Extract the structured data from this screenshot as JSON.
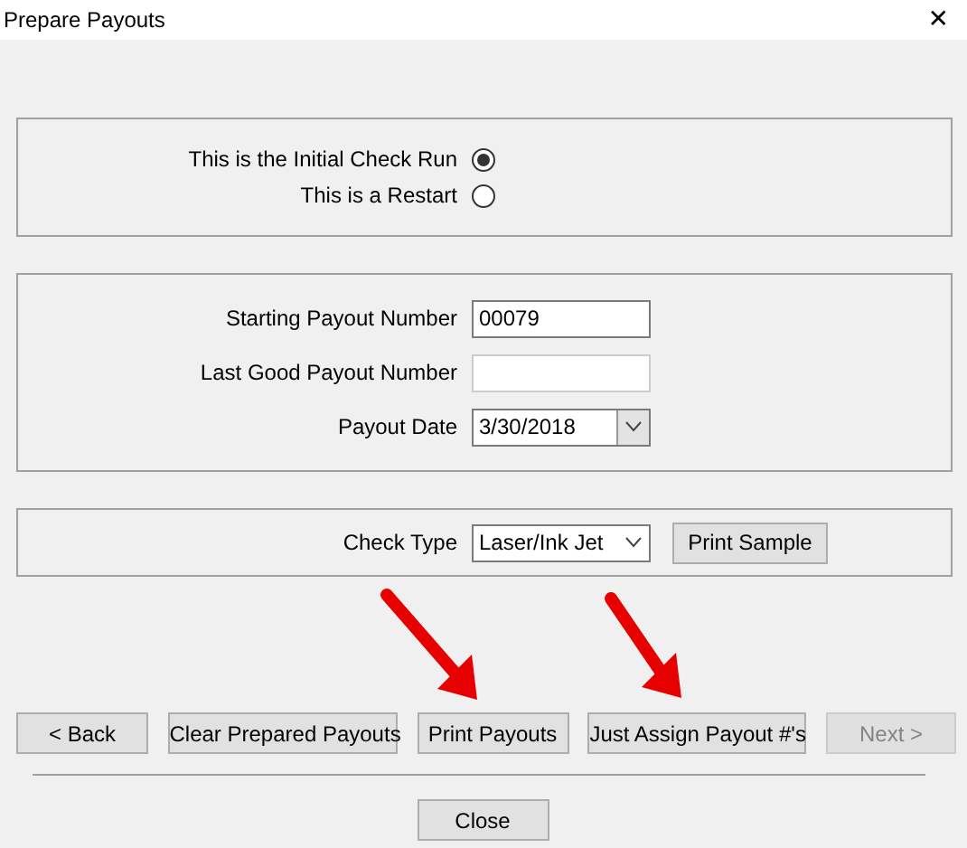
{
  "window": {
    "title": "Prepare Payouts",
    "close": "✕"
  },
  "run_type": [
    {
      "label": "This is the Initial Check Run",
      "selected": true
    },
    {
      "label": "This is a Restart",
      "selected": false
    }
  ],
  "payout_fields": [
    {
      "kind": "text",
      "label": "Starting Payout Number",
      "value": "00079",
      "disabled": false
    },
    {
      "kind": "text",
      "label": "Last Good Payout Number",
      "disabled": true
    },
    {
      "kind": "date",
      "label": "Payout Date",
      "value": "3/30/2018",
      "disabled": false
    }
  ],
  "check_type": {
    "label": "Check Type",
    "value": "Laser/Ink Jet",
    "button": "Print Sample"
  },
  "buttons": [
    {
      "label": "<  Back",
      "disabled": false
    },
    {
      "label": "Clear Prepared Payouts",
      "disabled": false
    },
    {
      "label": "Print Payouts",
      "disabled": false
    },
    {
      "label": "Just Assign Payout #'s",
      "disabled": false
    },
    {
      "label": "Next >",
      "disabled": true
    }
  ],
  "close_button": "Close"
}
